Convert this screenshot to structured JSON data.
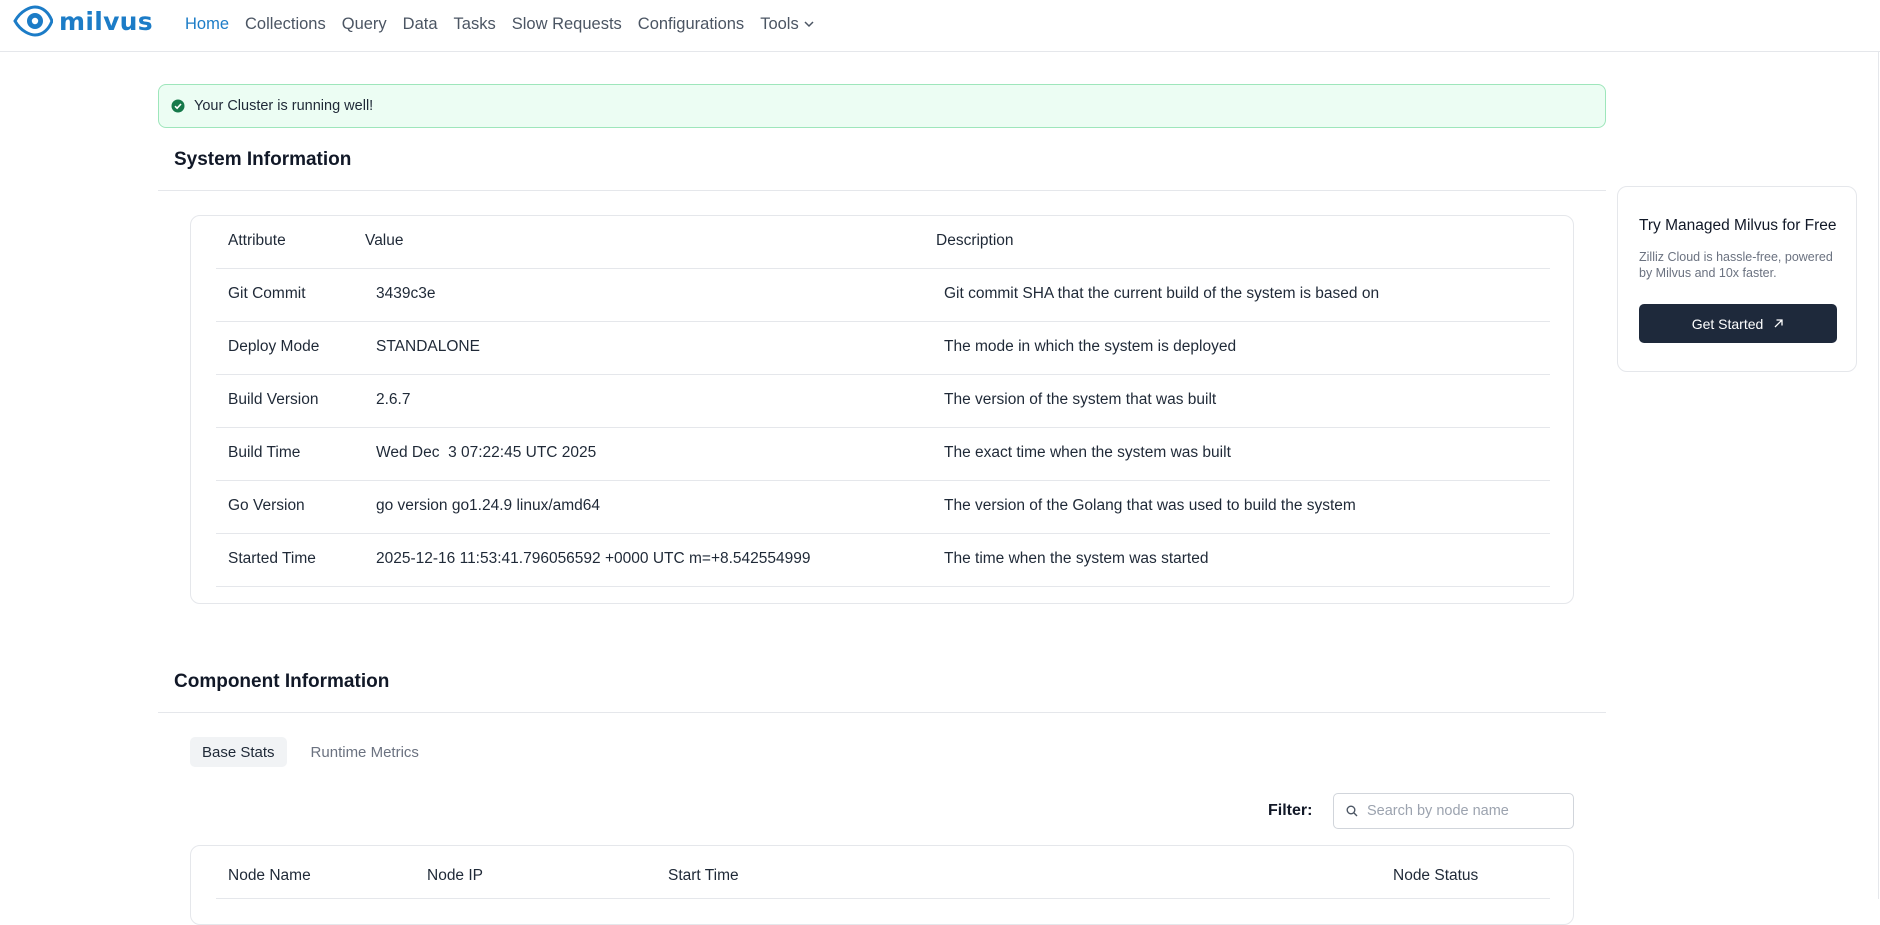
{
  "nav": {
    "logo": "milvus",
    "items": [
      "Home",
      "Collections",
      "Query",
      "Data",
      "Tasks",
      "Slow Requests",
      "Configurations",
      "Tools"
    ],
    "active": "Home"
  },
  "alert": {
    "message": "Your Cluster is running well!"
  },
  "system_info": {
    "title": "System Information",
    "headers": [
      "Attribute",
      "Value",
      "Description"
    ],
    "rows": [
      [
        "Git Commit",
        "3439c3e",
        "Git commit SHA that the current build of the system is based on"
      ],
      [
        "Deploy Mode",
        "STANDALONE",
        "The mode in which the system is deployed"
      ],
      [
        "Build Version",
        "2.6.7",
        "The version of the system that was built"
      ],
      [
        "Build Time",
        "Wed Dec  3 07:22:45 UTC 2025",
        "The exact time when the system was built"
      ],
      [
        "Go Version",
        "go version go1.24.9 linux/amd64",
        "The version of the Golang that was used to build the system"
      ],
      [
        "Started Time",
        "2025-12-16 11:53:41.796056592 +0000 UTC m=+8.542554999",
        "The time when the system was started"
      ]
    ]
  },
  "promo": {
    "title": "Try Managed Milvus for Free",
    "description": "Zilliz Cloud is hassle-free, powered by Milvus and 10x faster.",
    "button": "Get Started"
  },
  "component_info": {
    "title": "Component Information",
    "tabs": [
      "Base Stats",
      "Runtime Metrics"
    ],
    "active_tab": "Base Stats",
    "filter_label": "Filter:",
    "filter_placeholder": "Search by node name",
    "headers": [
      "Node Name",
      "Node IP",
      "Start Time",
      "Node Status"
    ]
  },
  "colors": {
    "brand": "#1c7cc7",
    "success": "#16a34a",
    "alert_bg": "#ecfdf3",
    "button_dark": "#1e293b"
  },
  "icons": [
    "milvus-eye-logo-icon",
    "chevron-down-icon",
    "check-circle-icon",
    "external-arrow-icon",
    "search-icon"
  ]
}
